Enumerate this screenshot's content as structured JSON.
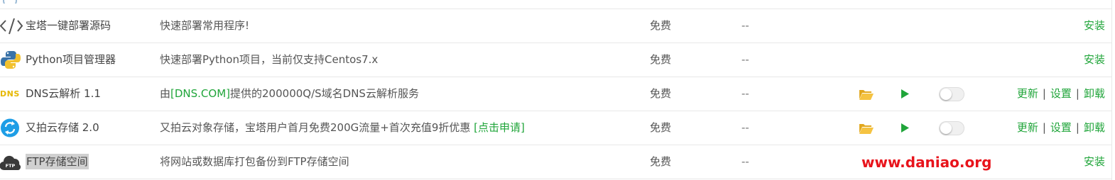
{
  "colors": {
    "accent": "#20a53a",
    "folder": "#f0b429",
    "watermark": "#e8141c",
    "border": "#e8e8e8"
  },
  "rows": [
    {
      "icon": "code-icon",
      "name": "宝塔一键部署源码",
      "desc": "快速部署常用程序!",
      "price": "免费",
      "expire": "--",
      "actions": [
        "安装"
      ]
    },
    {
      "icon": "python-icon",
      "name": "Python项目管理器",
      "desc": "快速部署Python项目，当前仅支持Centos7.x",
      "price": "免费",
      "expire": "--",
      "actions": [
        "安装"
      ]
    },
    {
      "icon": "dns-icon",
      "icon_text": "DNS",
      "name": "DNS云解析 1.1",
      "desc_prefix": "由",
      "desc_link": "[DNS.COM]",
      "desc_suffix": "提供的200000Q/S域名DNS云解析服务",
      "price": "免费",
      "expire": "--",
      "actions": [
        "更新",
        "设置",
        "卸载"
      ]
    },
    {
      "icon": "upyun-icon",
      "name": "又拍云存储 2.0",
      "desc": "又拍云对象存储，宝塔用户首月免费200G流量+首次充值9折优惠 ",
      "desc_link": "[点击申请]",
      "price": "免费",
      "expire": "--",
      "actions": [
        "更新",
        "设置",
        "卸载"
      ]
    },
    {
      "icon": "ftp-cloud-icon",
      "icon_text": "FTP",
      "name": "FTP存储空间",
      "desc": "将网站或数据库打包备份到FTP存储空间",
      "price": "免费",
      "expire": "--",
      "actions": [
        "安装"
      ]
    }
  ],
  "watermark": "www.daniao.org"
}
